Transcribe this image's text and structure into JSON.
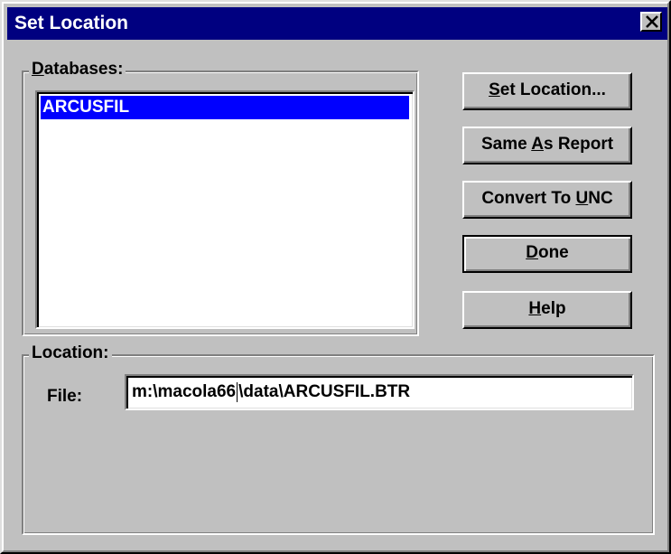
{
  "window": {
    "title": "Set Location"
  },
  "databases_group": {
    "label_mnemonic": "D",
    "label_rest": "atabases:",
    "items": [
      "ARCUSFIL"
    ],
    "selected_index": 0
  },
  "buttons": {
    "set_location": {
      "pre": "",
      "mnemonic": "S",
      "post": "et Location..."
    },
    "same_as_report": {
      "pre": "Same ",
      "mnemonic": "A",
      "post": "s Report"
    },
    "convert_to_unc": {
      "pre": "Convert To ",
      "mnemonic": "U",
      "post": "NC"
    },
    "done": {
      "pre": "",
      "mnemonic": "D",
      "post": "one"
    },
    "help": {
      "pre": "",
      "mnemonic": "H",
      "post": "elp"
    }
  },
  "location_group": {
    "label": "Location:",
    "file_label": "File:",
    "file_value_before_caret": "m:\\macola66",
    "file_value_after_caret": "\\data\\ARCUSFIL.BTR"
  },
  "colors": {
    "title_bar": "#000080",
    "selection": "#0000ff",
    "face": "#c0c0c0"
  },
  "icons": {
    "close": "close-icon"
  }
}
